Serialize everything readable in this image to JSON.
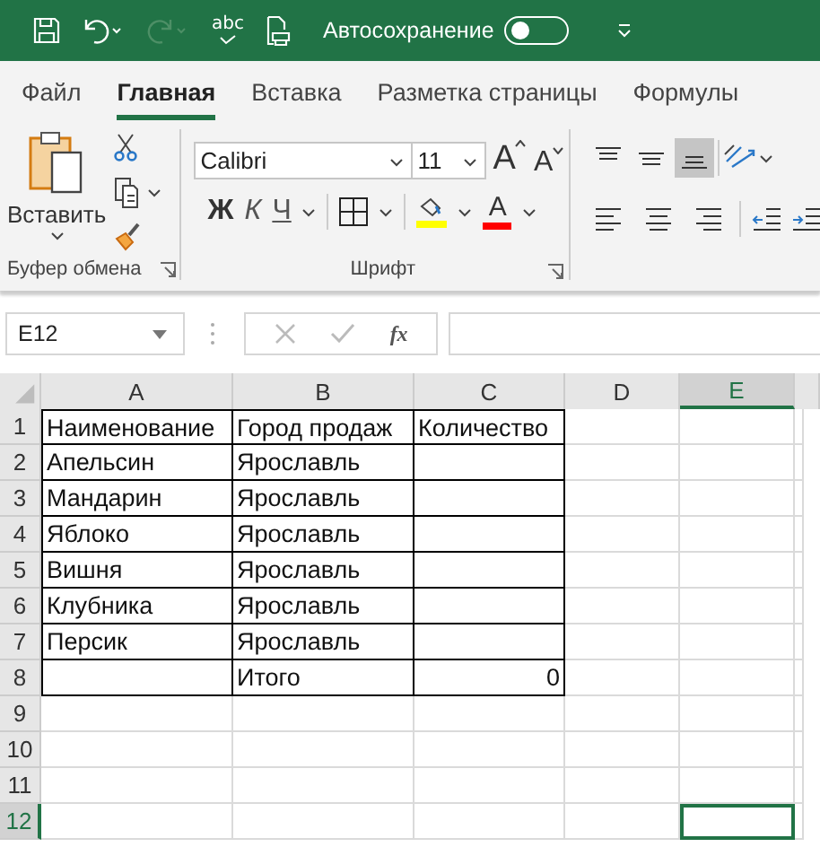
{
  "title_bar": {
    "spelling_label": "abc",
    "autosave_label": "Автосохранение",
    "autosave_on": false,
    "redo_disabled": true
  },
  "tabs": [
    {
      "label": "Файл",
      "selected": false
    },
    {
      "label": "Главная",
      "selected": true
    },
    {
      "label": "Вставка",
      "selected": false
    },
    {
      "label": "Разметка страницы",
      "selected": false
    },
    {
      "label": "Формулы",
      "selected": false
    }
  ],
  "clipboard": {
    "paste_label": "Вставить",
    "group_label": "Буфер обмена"
  },
  "font": {
    "name": "Calibri",
    "size": "11",
    "grow_label": "A",
    "shrink_label": "A",
    "bold_label": "Ж",
    "italic_label": "К",
    "underline_label": "Ч",
    "color_label": "A",
    "group_label": "Шрифт"
  },
  "alignment": {
    "vertical": [
      {
        "kind": "top",
        "selected": false
      },
      {
        "kind": "middle",
        "selected": false
      },
      {
        "kind": "bottom",
        "selected": true
      }
    ],
    "horizontal": [
      {
        "kind": "left",
        "selected": false
      },
      {
        "kind": "center",
        "selected": false
      },
      {
        "kind": "right",
        "selected": false
      }
    ]
  },
  "formula_bar": {
    "name_box": "E12",
    "fx_label": "fx",
    "enter_disabled": true
  },
  "sheet": {
    "columns": [
      {
        "label": "A",
        "selected": false
      },
      {
        "label": "B",
        "selected": false
      },
      {
        "label": "C",
        "selected": false
      },
      {
        "label": "D",
        "selected": false
      },
      {
        "label": "E",
        "selected": true
      }
    ],
    "rows": [
      {
        "number": "1",
        "selected": false,
        "bordered": true,
        "cells": [
          {
            "text": "Наименование",
            "kind": "text"
          },
          {
            "text": "Город продаж",
            "kind": "text"
          },
          {
            "text": "Количество",
            "kind": "text"
          }
        ]
      },
      {
        "number": "2",
        "selected": false,
        "bordered": true,
        "cells": [
          {
            "text": "Апельсин",
            "kind": "text"
          },
          {
            "text": "Ярославль",
            "kind": "text"
          },
          null
        ]
      },
      {
        "number": "3",
        "selected": false,
        "bordered": true,
        "cells": [
          {
            "text": "Мандарин",
            "kind": "text"
          },
          {
            "text": "Ярославль",
            "kind": "text"
          },
          null
        ]
      },
      {
        "number": "4",
        "selected": false,
        "bordered": true,
        "cells": [
          {
            "text": "Яблоко",
            "kind": "text"
          },
          {
            "text": "Ярославль",
            "kind": "text"
          },
          null
        ]
      },
      {
        "number": "5",
        "selected": false,
        "bordered": true,
        "cells": [
          {
            "text": "Вишня",
            "kind": "text"
          },
          {
            "text": "Ярославль",
            "kind": "text"
          },
          null
        ]
      },
      {
        "number": "6",
        "selected": false,
        "bordered": true,
        "cells": [
          {
            "text": "Клубника",
            "kind": "text"
          },
          {
            "text": "Ярославль",
            "kind": "text"
          },
          null
        ]
      },
      {
        "number": "7",
        "selected": false,
        "bordered": true,
        "cells": [
          {
            "text": "Персик",
            "kind": "text"
          },
          {
            "text": "Ярославль",
            "kind": "text"
          },
          null
        ]
      },
      {
        "number": "8",
        "selected": false,
        "bordered": true,
        "cells": [
          null,
          {
            "text": "Итого",
            "kind": "text"
          },
          {
            "text": "0",
            "kind": "number"
          }
        ]
      },
      {
        "number": "9",
        "selected": false,
        "bordered": false,
        "cells": []
      },
      {
        "number": "10",
        "selected": false,
        "bordered": false,
        "cells": []
      },
      {
        "number": "11",
        "selected": false,
        "bordered": false,
        "cells": []
      },
      {
        "number": "12",
        "selected": true,
        "bordered": false,
        "cells": []
      }
    ]
  }
}
